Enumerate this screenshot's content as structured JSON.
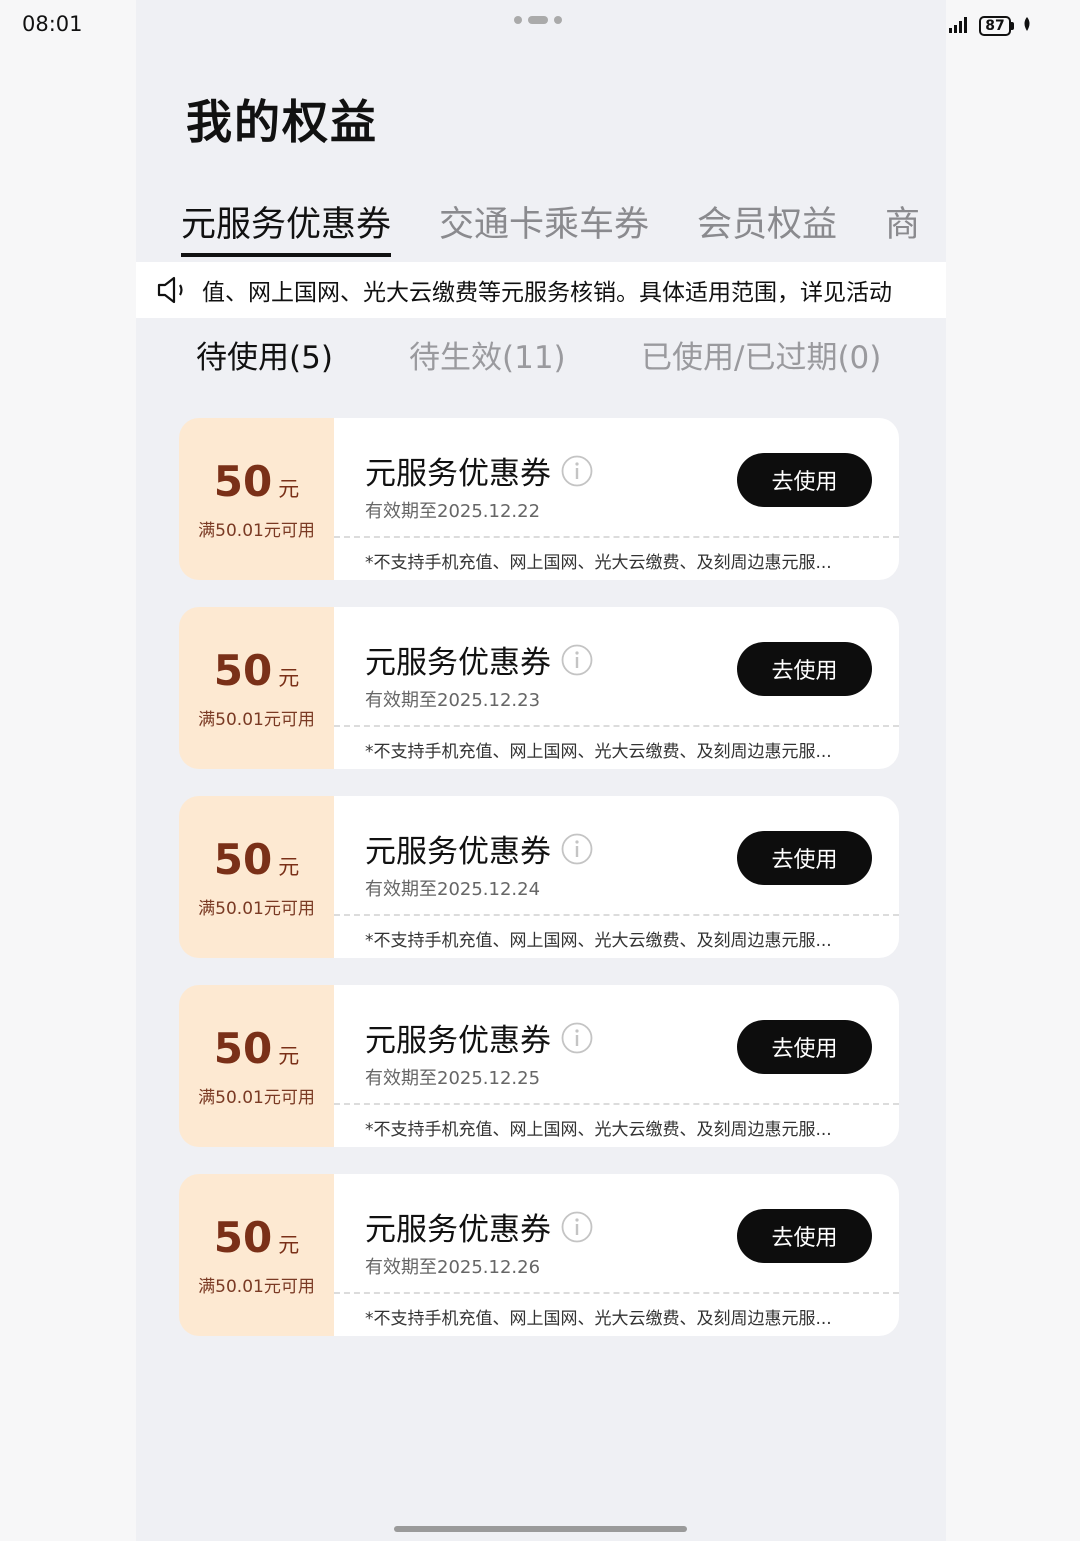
{
  "status_bar": {
    "time": "08:01",
    "battery": "87"
  },
  "page": {
    "title": "我的权益"
  },
  "tabs": [
    {
      "label": "元服务优惠券",
      "active": true
    },
    {
      "label": "交通卡乘车券",
      "active": false
    },
    {
      "label": "会员权益",
      "active": false
    },
    {
      "label": "商",
      "active": false
    }
  ],
  "notice": {
    "text": "值、网上国网、光大云缴费等元服务核销。具体适用范围，详见活动"
  },
  "subtabs": [
    {
      "label": "待使用(5)",
      "active": true
    },
    {
      "label": "待生效(11)",
      "active": false
    },
    {
      "label": "已使用/已过期(0)",
      "active": false
    }
  ],
  "coupons": [
    {
      "amount": "50",
      "unit": "元",
      "threshold": "满50.01元可用",
      "name": "元服务优惠券",
      "validity": "有效期至2025.12.22",
      "button": "去使用",
      "restriction": "*不支持手机充值、网上国网、光大云缴费、及刻周边惠元服..."
    },
    {
      "amount": "50",
      "unit": "元",
      "threshold": "满50.01元可用",
      "name": "元服务优惠券",
      "validity": "有效期至2025.12.23",
      "button": "去使用",
      "restriction": "*不支持手机充值、网上国网、光大云缴费、及刻周边惠元服..."
    },
    {
      "amount": "50",
      "unit": "元",
      "threshold": "满50.01元可用",
      "name": "元服务优惠券",
      "validity": "有效期至2025.12.24",
      "button": "去使用",
      "restriction": "*不支持手机充值、网上国网、光大云缴费、及刻周边惠元服..."
    },
    {
      "amount": "50",
      "unit": "元",
      "threshold": "满50.01元可用",
      "name": "元服务优惠券",
      "validity": "有效期至2025.12.25",
      "button": "去使用",
      "restriction": "*不支持手机充值、网上国网、光大云缴费、及刻周边惠元服..."
    },
    {
      "amount": "50",
      "unit": "元",
      "threshold": "满50.01元可用",
      "name": "元服务优惠券",
      "validity": "有效期至2025.12.26",
      "button": "去使用",
      "restriction": "*不支持手机充值、网上国网、光大云缴费、及刻周边惠元服..."
    }
  ],
  "colors": {
    "coupon_left_bg": "#fde9d2",
    "amount_text": "#7a3018",
    "button_bg": "#0d0d0d"
  }
}
